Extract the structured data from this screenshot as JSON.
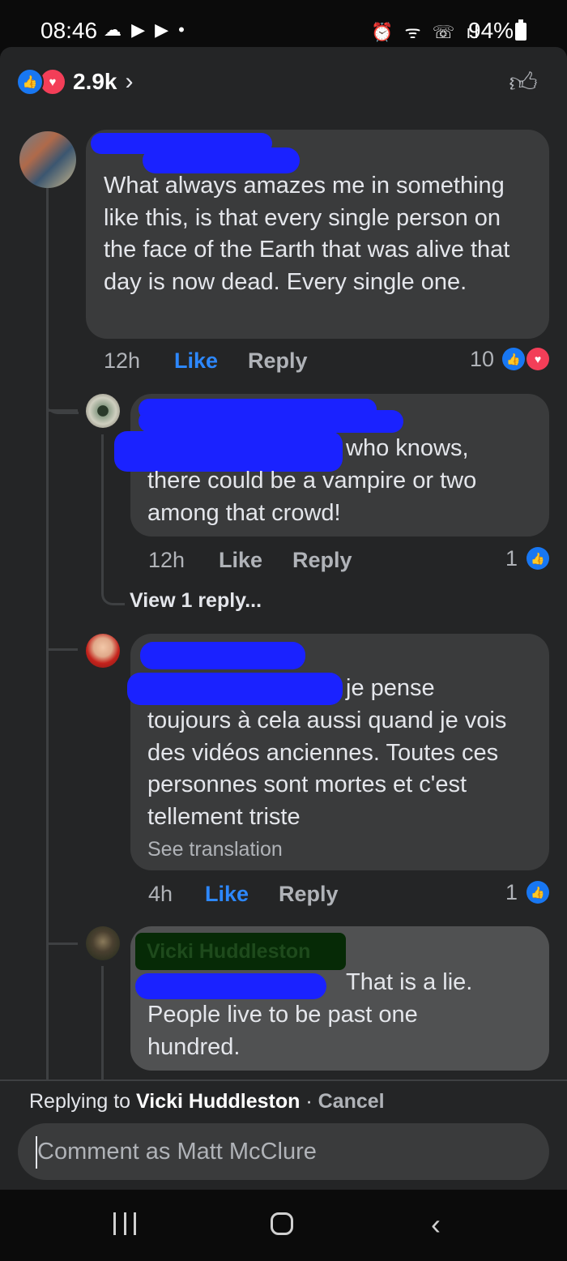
{
  "status_bar": {
    "time": "08:46",
    "left_indicators": "☁ ▶ ▶ •",
    "right_indicators": "⏰ ᯤ ☏ ıl",
    "battery": "94%"
  },
  "reactions": {
    "count": "2.9k",
    "chevron": "›",
    "like_icon": "like-reaction-icon",
    "love_icon": "love-reaction-icon"
  },
  "comments": [
    {
      "author": "",
      "text": "What always amazes me in something like this, is that every single person on the face of the Earth that was alive that day is now dead. Every single one.",
      "time": "12h",
      "like_label": "Like",
      "reply_label": "Reply",
      "reaction_count": "10"
    },
    {
      "author": "",
      "text_lead": "who knows,",
      "text_rest": "there could be a vampire or two among that crowd!",
      "time": "12h",
      "like_label": "Like",
      "reply_label": "Reply",
      "reaction_count": "1",
      "view_replies": "View 1 reply..."
    },
    {
      "author": "",
      "text_lead": "je pense",
      "text_rest": "toujours à cela aussi quand je vois des vidéos anciennes. Toutes ces personnes sont mortes et c'est tellement triste",
      "see_translation": "See translation",
      "time": "4h",
      "like_label": "Like",
      "reply_label": "Reply",
      "reaction_count": "1"
    },
    {
      "author": "Vicki Huddleston",
      "text_lead": "That is a lie.",
      "text_rest": "People live to be past one hundred."
    }
  ],
  "reply_bar": {
    "prefix": "Replying to ",
    "name": "Vicki Huddleston",
    "separator": " · ",
    "cancel": "Cancel",
    "placeholder": "Comment as Matt McClure"
  },
  "nav": {
    "back": "‹"
  }
}
